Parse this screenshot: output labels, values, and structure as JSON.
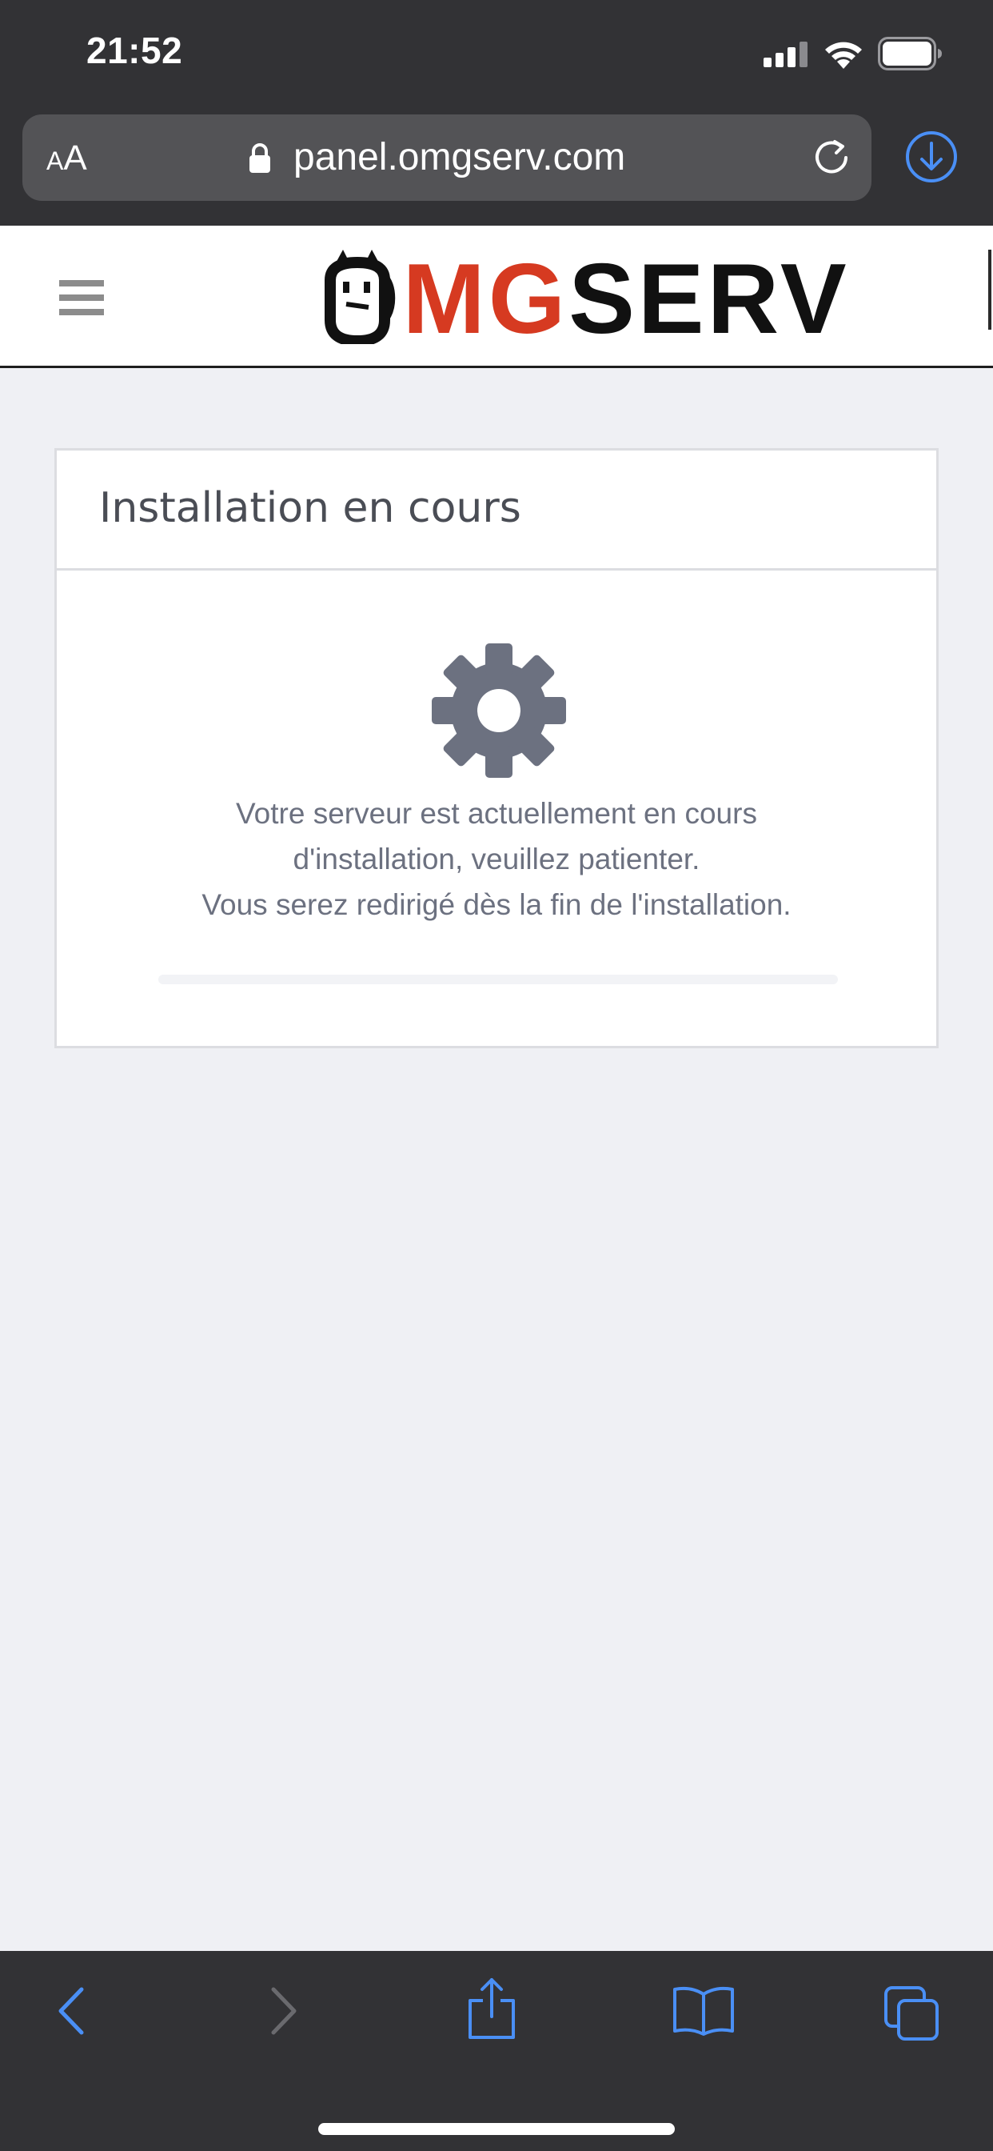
{
  "status_bar": {
    "time": "21:52",
    "icons": [
      "cellular-signal-icon",
      "wifi-icon",
      "battery-icon"
    ]
  },
  "browser": {
    "text_size_small": "A",
    "text_size_large": "A",
    "url": "panel.omgserv.com",
    "icons": [
      "lock-icon",
      "reload-icon",
      "download-icon"
    ],
    "accent_color": "#4a8ff5",
    "chrome_color": "#323235"
  },
  "site": {
    "logo": {
      "part_o": "O",
      "part_mg": "MG",
      "part_serv": "SERV",
      "red_color": "#d63a21",
      "black_color": "#111111"
    },
    "menu_icon": "hamburger-icon"
  },
  "card": {
    "title": "Installation en cours",
    "icon": "gear-icon",
    "message_lines": [
      "Votre serveur est actuellement en cours",
      "d'installation, veuillez patienter.",
      "Vous serez redirigé dès la fin de l'installation."
    ],
    "progress_percent": 0
  },
  "toolbar": {
    "icons": [
      "back-icon",
      "forward-icon",
      "share-icon",
      "bookmarks-icon",
      "tabs-icon"
    ]
  }
}
